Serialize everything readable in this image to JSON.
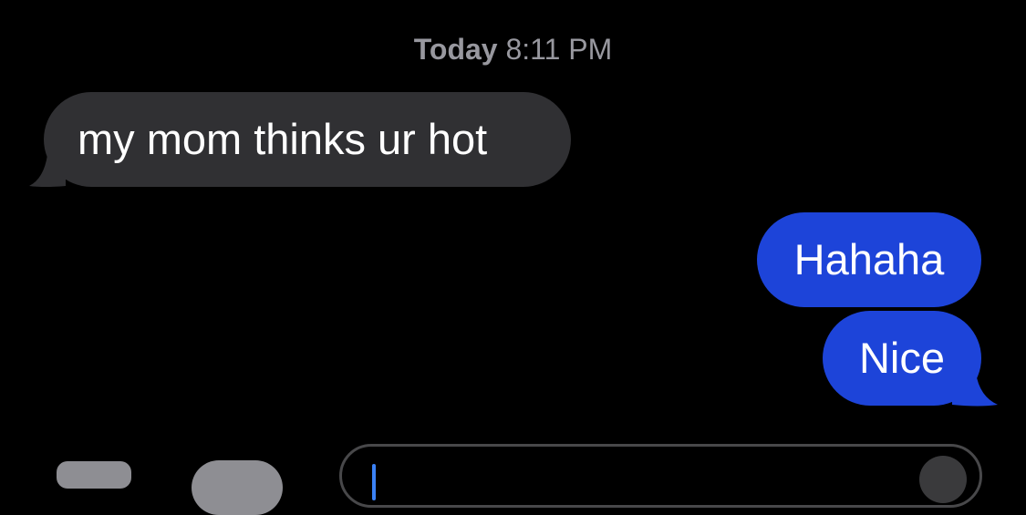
{
  "thread": {
    "timestamp_day": "Today",
    "timestamp_time": "8:11 PM",
    "messages": [
      {
        "direction": "received",
        "text": "my mom thinks ur hot"
      },
      {
        "direction": "sent",
        "text": "Hahaha"
      },
      {
        "direction": "sent",
        "text": "Nice"
      }
    ]
  },
  "input_bar": {
    "placeholder": "",
    "camera_icon": "camera-icon",
    "apps_icon": "app-store-icon",
    "mic_icon": "microphone-icon"
  },
  "colors": {
    "background": "#000000",
    "received_bubble": "#303033",
    "sent_bubble": "#1d44d9",
    "timestamp_text": "#98989f",
    "cursor": "#3b82f6"
  }
}
